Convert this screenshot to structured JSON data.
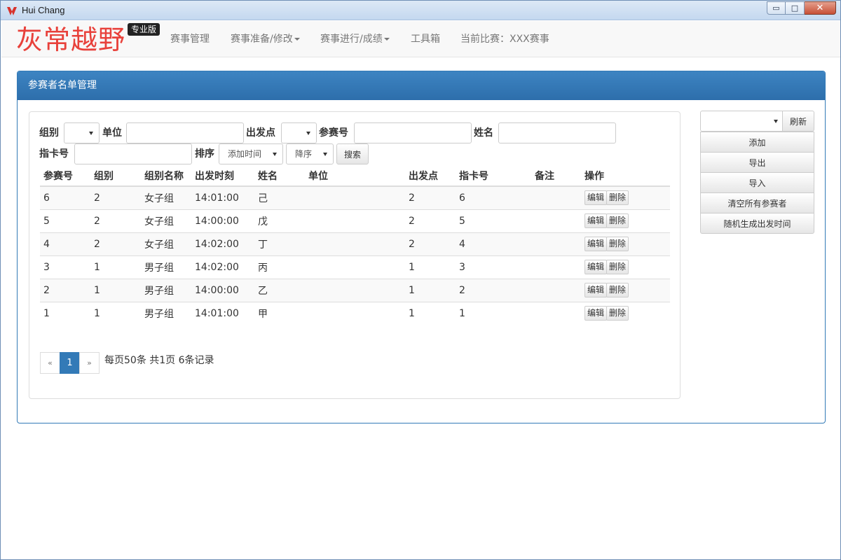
{
  "window": {
    "title": "Hui Chang",
    "minimize": "▭",
    "maximize": "□",
    "close": "✕"
  },
  "nav": {
    "brand": "灰常越野",
    "edition": "专业版",
    "items": [
      "赛事管理",
      "赛事准备/修改",
      "赛事进行/成绩",
      "工具箱",
      "当前比赛：XXX赛事"
    ]
  },
  "panel": {
    "title": "参赛者名单管理"
  },
  "filters": {
    "group_label": "组别",
    "unit_label": "单位",
    "start_label": "出发点",
    "bib_label": "参赛号",
    "name_label": "姓名",
    "card_label": "指卡号",
    "sort_label": "排序",
    "sort_value": "添加时间",
    "order_value": "降序",
    "search_button": "搜索"
  },
  "table": {
    "headers": [
      "参赛号",
      "组别",
      "组别名称",
      "出发时刻",
      "姓名",
      "单位",
      "出发点",
      "指卡号",
      "备注",
      "操作"
    ],
    "edit_label": "编辑",
    "delete_label": "删除",
    "rows": [
      [
        "6",
        "2",
        "女子组",
        "14:01:00",
        "己",
        "",
        "2",
        "6",
        ""
      ],
      [
        "5",
        "2",
        "女子组",
        "14:00:00",
        "戊",
        "",
        "2",
        "5",
        ""
      ],
      [
        "4",
        "2",
        "女子组",
        "14:02:00",
        "丁",
        "",
        "2",
        "4",
        ""
      ],
      [
        "3",
        "1",
        "男子组",
        "14:02:00",
        "丙",
        "",
        "1",
        "3",
        ""
      ],
      [
        "2",
        "1",
        "男子组",
        "14:00:00",
        "乙",
        "",
        "1",
        "2",
        ""
      ],
      [
        "1",
        "1",
        "男子组",
        "14:01:00",
        "甲",
        "",
        "1",
        "1",
        ""
      ]
    ]
  },
  "pager": {
    "prev": "«",
    "current": "1",
    "next": "»",
    "info": "每页50条 共1页 6条记录"
  },
  "side": {
    "refresh": "刷新",
    "buttons": [
      "添加",
      "导出",
      "导入",
      "清空所有参赛者",
      "随机生成出发时间"
    ]
  },
  "colors": {
    "brand": "#e8413b",
    "primary": "#337ab7"
  }
}
